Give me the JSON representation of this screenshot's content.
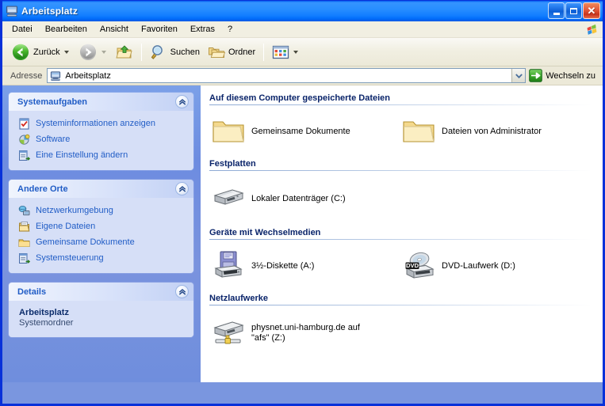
{
  "window": {
    "title": "Arbeitsplatz",
    "icon": "my-computer-icon",
    "minimize_label": "Minimieren",
    "maximize_label": "Maximieren",
    "close_label": "Schließen"
  },
  "menubar": {
    "items": [
      {
        "label": "Datei"
      },
      {
        "label": "Bearbeiten"
      },
      {
        "label": "Ansicht"
      },
      {
        "label": "Favoriten"
      },
      {
        "label": "Extras"
      },
      {
        "label": "?"
      }
    ]
  },
  "toolbar": {
    "back_label": "Zurück",
    "forward_label": "",
    "up_label": "",
    "search_label": "Suchen",
    "folders_label": "Ordner",
    "views_label": ""
  },
  "addressbar": {
    "label": "Adresse",
    "value": "Arbeitsplatz",
    "icon": "my-computer-icon",
    "go_label": "Wechseln zu"
  },
  "sidebar": {
    "panels": [
      {
        "title": "Systemaufgaben",
        "collapse_icon": "chevron-up-icon",
        "rows": [
          {
            "label": "Systeminformationen anzeigen",
            "icon": "system-info-icon"
          },
          {
            "label": "Software",
            "icon": "add-remove-programs-icon"
          },
          {
            "label": "Eine Einstellung ändern",
            "icon": "change-setting-icon"
          }
        ]
      },
      {
        "title": "Andere Orte",
        "collapse_icon": "chevron-up-icon",
        "rows": [
          {
            "label": "Netzwerkumgebung",
            "icon": "network-places-icon"
          },
          {
            "label": "Eigene Dateien",
            "icon": "my-documents-icon"
          },
          {
            "label": "Gemeinsame Dokumente",
            "icon": "shared-documents-icon"
          },
          {
            "label": "Systemsteuerung",
            "icon": "control-panel-icon"
          }
        ]
      }
    ],
    "details": {
      "title": "Details",
      "collapse_icon": "chevron-up-icon",
      "name": "Arbeitsplatz",
      "type": "Systemordner"
    }
  },
  "main": {
    "groups": [
      {
        "id": "files",
        "heading": "Auf diesem Computer gespeicherte Dateien",
        "items": [
          {
            "label": "Gemeinsame Dokumente",
            "icon": "folder-icon"
          },
          {
            "label": "Dateien von Administrator",
            "icon": "folder-icon"
          }
        ]
      },
      {
        "id": "hdd",
        "heading": "Festplatten",
        "items": [
          {
            "label": "Lokaler Datenträger (C:)",
            "icon": "hard-disk-icon"
          }
        ]
      },
      {
        "id": "rem",
        "heading": "Geräte mit Wechselmedien",
        "items": [
          {
            "label": "3½-Diskette (A:)",
            "icon": "floppy-drive-icon"
          },
          {
            "label": "DVD-Laufwerk (D:)",
            "icon": "dvd-drive-icon"
          }
        ]
      },
      {
        "id": "net",
        "heading": "Netzlaufwerke",
        "items": [
          {
            "label": "physnet.uni-hamburg.de auf \"afs\" (Z:)",
            "icon": "network-drive-icon"
          }
        ]
      }
    ]
  },
  "colors": {
    "title_blue": "#0058ee",
    "window_border": "#0831d9",
    "sidebar_blue": "#7a96df",
    "panel_body": "#d6dff7",
    "link_blue": "#215dc6",
    "group_heading": "#0a246a",
    "toolbar_beige": "#ece9d8"
  }
}
